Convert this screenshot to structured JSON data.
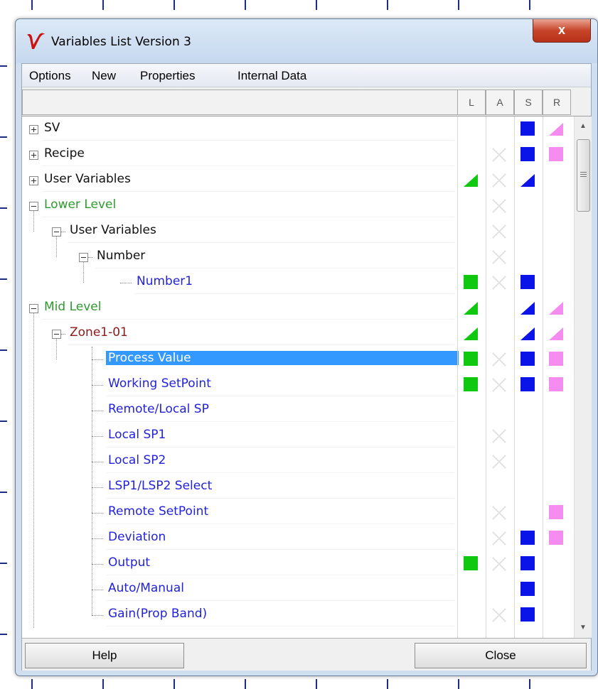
{
  "window": {
    "title": "Variables List Version 3",
    "close_glyph": "x"
  },
  "menu": [
    "Options",
    "New",
    "Properties",
    "Internal Data"
  ],
  "columns": [
    "L",
    "A",
    "S",
    "R"
  ],
  "colors": {
    "green_item": "#2e9a2e",
    "blue_item": "#2222dd",
    "darkred_item": "#8b1a1a",
    "black_item": "#111111",
    "mark_green": "#11c811",
    "mark_blue": "#0a14e8",
    "mark_pink": "#f58cf0",
    "selection": "#3399ff"
  },
  "rows": [
    {
      "label": "SV",
      "level": 0,
      "expander": "plus",
      "color": "black",
      "marks": [
        "",
        "",
        "sq-blue",
        "tri-pink"
      ]
    },
    {
      "label": "Recipe",
      "level": 0,
      "expander": "plus",
      "color": "black",
      "marks": [
        "",
        "x",
        "sq-blue",
        "sq-pink"
      ]
    },
    {
      "label": "User Variables",
      "level": 0,
      "expander": "plus",
      "color": "black",
      "marks": [
        "tri-green",
        "x",
        "tri-blue",
        ""
      ]
    },
    {
      "label": "Lower Level",
      "level": 0,
      "expander": "minus",
      "color": "green",
      "marks": [
        "",
        "x",
        "",
        ""
      ]
    },
    {
      "label": "User Variables",
      "level": 1,
      "expander": "minus",
      "color": "black",
      "marks": [
        "",
        "x",
        "",
        ""
      ]
    },
    {
      "label": "Number",
      "level": 2,
      "expander": "minus",
      "color": "black",
      "marks": [
        "",
        "x",
        "",
        ""
      ]
    },
    {
      "label": "Number1",
      "level": 3,
      "expander": "none",
      "color": "blue",
      "marks": [
        "sq-green",
        "x",
        "sq-blue",
        ""
      ]
    },
    {
      "label": "Mid Level",
      "level": 0,
      "expander": "minus",
      "color": "green",
      "marks": [
        "tri-green",
        "",
        "tri-blue",
        "tri-pink"
      ]
    },
    {
      "label": "Zone1-01",
      "level": 1,
      "expander": "minus",
      "color": "darkred",
      "marks": [
        "tri-green",
        "",
        "tri-blue",
        "tri-pink"
      ]
    },
    {
      "label": "Process Value",
      "level": 2,
      "expander": "none",
      "color": "blue",
      "selected": true,
      "marks": [
        "sq-green",
        "x",
        "sq-blue",
        "sq-pink"
      ]
    },
    {
      "label": "Working SetPoint",
      "level": 2,
      "expander": "none",
      "color": "blue",
      "marks": [
        "sq-green",
        "x",
        "sq-blue",
        "sq-pink"
      ]
    },
    {
      "label": "Remote/Local SP",
      "level": 2,
      "expander": "none",
      "color": "blue",
      "marks": [
        "",
        "",
        "",
        ""
      ]
    },
    {
      "label": "Local SP1",
      "level": 2,
      "expander": "none",
      "color": "blue",
      "marks": [
        "",
        "x",
        "",
        ""
      ]
    },
    {
      "label": "Local SP2",
      "level": 2,
      "expander": "none",
      "color": "blue",
      "marks": [
        "",
        "x",
        "",
        ""
      ]
    },
    {
      "label": "LSP1/LSP2 Select",
      "level": 2,
      "expander": "none",
      "color": "blue",
      "marks": [
        "",
        "",
        "",
        ""
      ]
    },
    {
      "label": "Remote SetPoint",
      "level": 2,
      "expander": "none",
      "color": "blue",
      "marks": [
        "",
        "x",
        "",
        "sq-pink"
      ]
    },
    {
      "label": "Deviation",
      "level": 2,
      "expander": "none",
      "color": "blue",
      "marks": [
        "",
        "x",
        "sq-blue",
        "sq-pink"
      ]
    },
    {
      "label": "Output",
      "level": 2,
      "expander": "none",
      "color": "blue",
      "marks": [
        "sq-green",
        "x",
        "sq-blue",
        ""
      ]
    },
    {
      "label": "Auto/Manual",
      "level": 2,
      "expander": "none",
      "color": "blue",
      "marks": [
        "",
        "",
        "sq-blue",
        ""
      ]
    },
    {
      "label": "Gain(Prop Band)",
      "level": 2,
      "expander": "none",
      "color": "blue",
      "marks": [
        "",
        "x",
        "sq-blue",
        ""
      ]
    }
  ],
  "buttons": {
    "help": "Help",
    "close": "Close"
  }
}
